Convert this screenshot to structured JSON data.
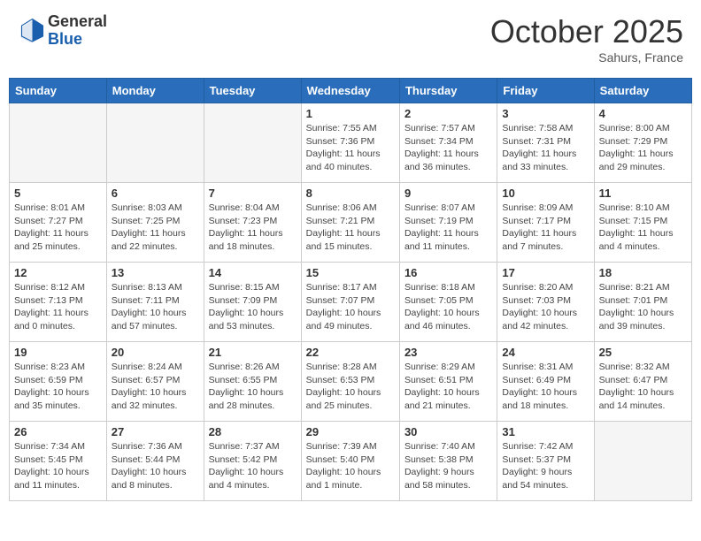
{
  "header": {
    "logo_general": "General",
    "logo_blue": "Blue",
    "month": "October 2025",
    "location": "Sahurs, France"
  },
  "days_of_week": [
    "Sunday",
    "Monday",
    "Tuesday",
    "Wednesday",
    "Thursday",
    "Friday",
    "Saturday"
  ],
  "weeks": [
    [
      {
        "day": "",
        "info": ""
      },
      {
        "day": "",
        "info": ""
      },
      {
        "day": "",
        "info": ""
      },
      {
        "day": "1",
        "info": "Sunrise: 7:55 AM\nSunset: 7:36 PM\nDaylight: 11 hours\nand 40 minutes."
      },
      {
        "day": "2",
        "info": "Sunrise: 7:57 AM\nSunset: 7:34 PM\nDaylight: 11 hours\nand 36 minutes."
      },
      {
        "day": "3",
        "info": "Sunrise: 7:58 AM\nSunset: 7:31 PM\nDaylight: 11 hours\nand 33 minutes."
      },
      {
        "day": "4",
        "info": "Sunrise: 8:00 AM\nSunset: 7:29 PM\nDaylight: 11 hours\nand 29 minutes."
      }
    ],
    [
      {
        "day": "5",
        "info": "Sunrise: 8:01 AM\nSunset: 7:27 PM\nDaylight: 11 hours\nand 25 minutes."
      },
      {
        "day": "6",
        "info": "Sunrise: 8:03 AM\nSunset: 7:25 PM\nDaylight: 11 hours\nand 22 minutes."
      },
      {
        "day": "7",
        "info": "Sunrise: 8:04 AM\nSunset: 7:23 PM\nDaylight: 11 hours\nand 18 minutes."
      },
      {
        "day": "8",
        "info": "Sunrise: 8:06 AM\nSunset: 7:21 PM\nDaylight: 11 hours\nand 15 minutes."
      },
      {
        "day": "9",
        "info": "Sunrise: 8:07 AM\nSunset: 7:19 PM\nDaylight: 11 hours\nand 11 minutes."
      },
      {
        "day": "10",
        "info": "Sunrise: 8:09 AM\nSunset: 7:17 PM\nDaylight: 11 hours\nand 7 minutes."
      },
      {
        "day": "11",
        "info": "Sunrise: 8:10 AM\nSunset: 7:15 PM\nDaylight: 11 hours\nand 4 minutes."
      }
    ],
    [
      {
        "day": "12",
        "info": "Sunrise: 8:12 AM\nSunset: 7:13 PM\nDaylight: 11 hours\nand 0 minutes."
      },
      {
        "day": "13",
        "info": "Sunrise: 8:13 AM\nSunset: 7:11 PM\nDaylight: 10 hours\nand 57 minutes."
      },
      {
        "day": "14",
        "info": "Sunrise: 8:15 AM\nSunset: 7:09 PM\nDaylight: 10 hours\nand 53 minutes."
      },
      {
        "day": "15",
        "info": "Sunrise: 8:17 AM\nSunset: 7:07 PM\nDaylight: 10 hours\nand 49 minutes."
      },
      {
        "day": "16",
        "info": "Sunrise: 8:18 AM\nSunset: 7:05 PM\nDaylight: 10 hours\nand 46 minutes."
      },
      {
        "day": "17",
        "info": "Sunrise: 8:20 AM\nSunset: 7:03 PM\nDaylight: 10 hours\nand 42 minutes."
      },
      {
        "day": "18",
        "info": "Sunrise: 8:21 AM\nSunset: 7:01 PM\nDaylight: 10 hours\nand 39 minutes."
      }
    ],
    [
      {
        "day": "19",
        "info": "Sunrise: 8:23 AM\nSunset: 6:59 PM\nDaylight: 10 hours\nand 35 minutes."
      },
      {
        "day": "20",
        "info": "Sunrise: 8:24 AM\nSunset: 6:57 PM\nDaylight: 10 hours\nand 32 minutes."
      },
      {
        "day": "21",
        "info": "Sunrise: 8:26 AM\nSunset: 6:55 PM\nDaylight: 10 hours\nand 28 minutes."
      },
      {
        "day": "22",
        "info": "Sunrise: 8:28 AM\nSunset: 6:53 PM\nDaylight: 10 hours\nand 25 minutes."
      },
      {
        "day": "23",
        "info": "Sunrise: 8:29 AM\nSunset: 6:51 PM\nDaylight: 10 hours\nand 21 minutes."
      },
      {
        "day": "24",
        "info": "Sunrise: 8:31 AM\nSunset: 6:49 PM\nDaylight: 10 hours\nand 18 minutes."
      },
      {
        "day": "25",
        "info": "Sunrise: 8:32 AM\nSunset: 6:47 PM\nDaylight: 10 hours\nand 14 minutes."
      }
    ],
    [
      {
        "day": "26",
        "info": "Sunrise: 7:34 AM\nSunset: 5:45 PM\nDaylight: 10 hours\nand 11 minutes."
      },
      {
        "day": "27",
        "info": "Sunrise: 7:36 AM\nSunset: 5:44 PM\nDaylight: 10 hours\nand 8 minutes."
      },
      {
        "day": "28",
        "info": "Sunrise: 7:37 AM\nSunset: 5:42 PM\nDaylight: 10 hours\nand 4 minutes."
      },
      {
        "day": "29",
        "info": "Sunrise: 7:39 AM\nSunset: 5:40 PM\nDaylight: 10 hours\nand 1 minute."
      },
      {
        "day": "30",
        "info": "Sunrise: 7:40 AM\nSunset: 5:38 PM\nDaylight: 9 hours\nand 58 minutes."
      },
      {
        "day": "31",
        "info": "Sunrise: 7:42 AM\nSunset: 5:37 PM\nDaylight: 9 hours\nand 54 minutes."
      },
      {
        "day": "",
        "info": ""
      }
    ]
  ]
}
